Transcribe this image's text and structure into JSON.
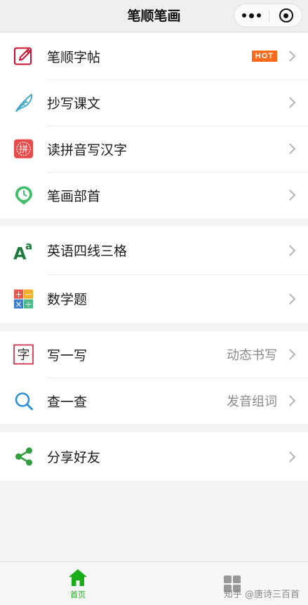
{
  "nav": {
    "title": "笔顺笔画"
  },
  "groups": [
    {
      "items": [
        {
          "label": "笔顺字帖",
          "badge": "HOT",
          "icon": "edit-square-icon"
        },
        {
          "label": "抄写课文",
          "icon": "feather-icon"
        },
        {
          "label": "读拼音写汉字",
          "icon": "pinyin-stamp-icon",
          "icon_char": "拼"
        },
        {
          "label": "笔画部首",
          "icon": "clock-pin-icon"
        }
      ]
    },
    {
      "items": [
        {
          "label": "英语四线三格",
          "icon": "letter-aa-icon",
          "icon_text": "A",
          "icon_sup": "a"
        },
        {
          "label": "数学题",
          "icon": "math-operators-icon",
          "ops": [
            "+",
            "−",
            "×",
            "÷"
          ]
        }
      ]
    },
    {
      "items": [
        {
          "label": "写一写",
          "right_text": "动态书写",
          "icon": "char-grid-icon",
          "icon_char": "字"
        },
        {
          "label": "查一查",
          "right_text": "发音组词",
          "icon": "search-icon"
        }
      ]
    },
    {
      "items": [
        {
          "label": "分享好友",
          "icon": "share-icon"
        }
      ]
    }
  ],
  "tabbar": {
    "home_label": "首页",
    "watermark": "知乎 @唐诗三百首"
  },
  "colors": {
    "accent": "#1aad19",
    "hot": "#ff6a1a",
    "primary_green": "#2e9e3e"
  }
}
